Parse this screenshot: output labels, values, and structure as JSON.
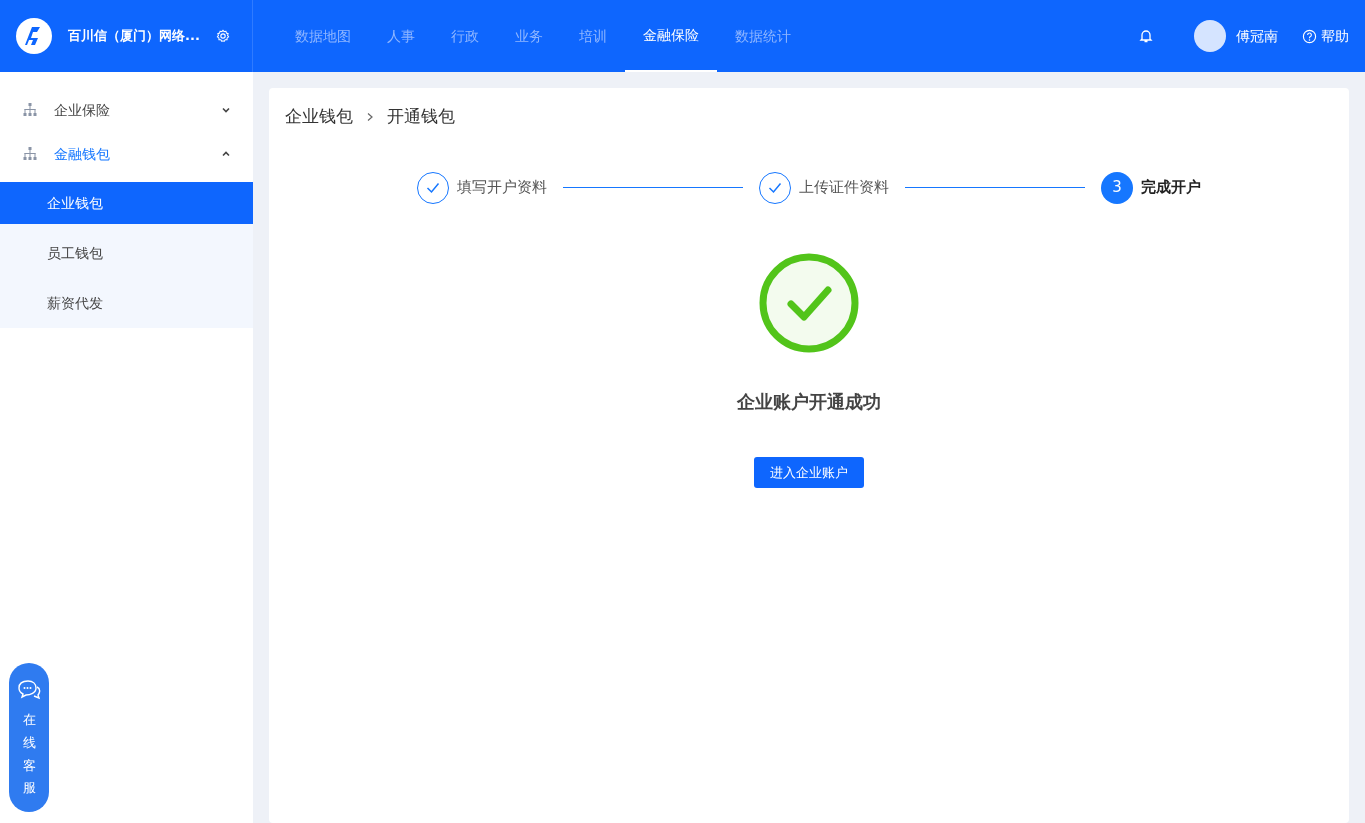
{
  "header": {
    "company": "百川信（厦门）网络...",
    "nav": [
      {
        "label": "数据地图",
        "selected": false
      },
      {
        "label": "人事",
        "selected": false
      },
      {
        "label": "行政",
        "selected": false
      },
      {
        "label": "业务",
        "selected": false
      },
      {
        "label": "培训",
        "selected": false
      },
      {
        "label": "金融保险",
        "selected": true
      },
      {
        "label": "数据统计",
        "selected": false
      }
    ],
    "user": "傅冠南",
    "help": "帮助"
  },
  "sidebar": {
    "groups": [
      {
        "label": "企业保险",
        "expanded": false
      },
      {
        "label": "金融钱包",
        "expanded": true,
        "children": [
          {
            "label": "企业钱包",
            "selected": true
          },
          {
            "label": "员工钱包",
            "selected": false
          },
          {
            "label": "薪资代发",
            "selected": false
          }
        ]
      }
    ]
  },
  "chat_button": "在线客服",
  "breadcrumb": [
    "企业钱包",
    "开通钱包"
  ],
  "steps": [
    {
      "label": "填写开户资料",
      "kind": "done"
    },
    {
      "label": "上传证件资料",
      "kind": "done"
    },
    {
      "label": "完成开户",
      "kind": "current",
      "number": "3"
    }
  ],
  "result": {
    "message": "企业账户开通成功",
    "button": "进入企业账户"
  }
}
